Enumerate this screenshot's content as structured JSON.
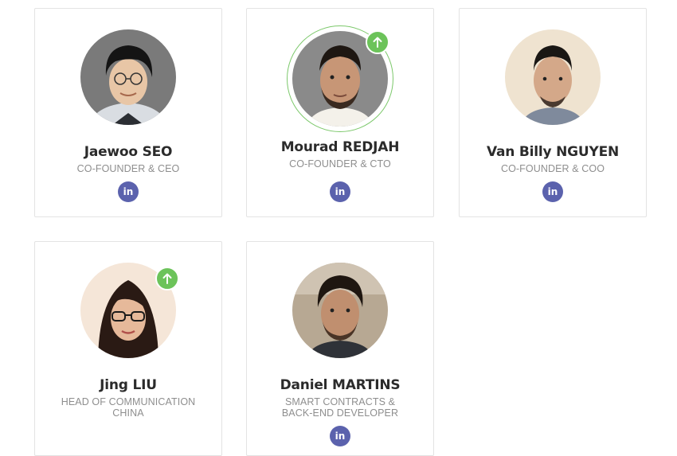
{
  "team": [
    {
      "name": "Jaewoo SEO",
      "role": "CO-FOUNDER & CEO",
      "linkedin_icon": "linkedin-icon",
      "linkedin_label": "in",
      "featured": false
    },
    {
      "name": "Mourad REDJAH",
      "role": "CO-FOUNDER & CTO",
      "linkedin_icon": "linkedin-icon",
      "linkedin_label": "in",
      "featured": true
    },
    {
      "name": "Van Billy NGUYEN",
      "role": "CO-FOUNDER & COO",
      "linkedin_icon": "linkedin-icon",
      "linkedin_label": "in",
      "featured": false
    },
    {
      "name": "Jing LIU",
      "role": "HEAD OF COMMUNICATION CHINA",
      "featured": true
    },
    {
      "name": "Daniel MARTINS",
      "role": "SMART CONTRACTS & BACK-END DEVELOPER",
      "linkedin_icon": "linkedin-icon",
      "linkedin_label": "in",
      "featured": false
    }
  ],
  "badge_icon": "arrow-up-icon",
  "colors": {
    "badge": "#6cc35a",
    "linkedin": "#5b62ad",
    "ring": "#7cc86b",
    "name": "#2b2b2b",
    "role": "#8e8e8e"
  }
}
